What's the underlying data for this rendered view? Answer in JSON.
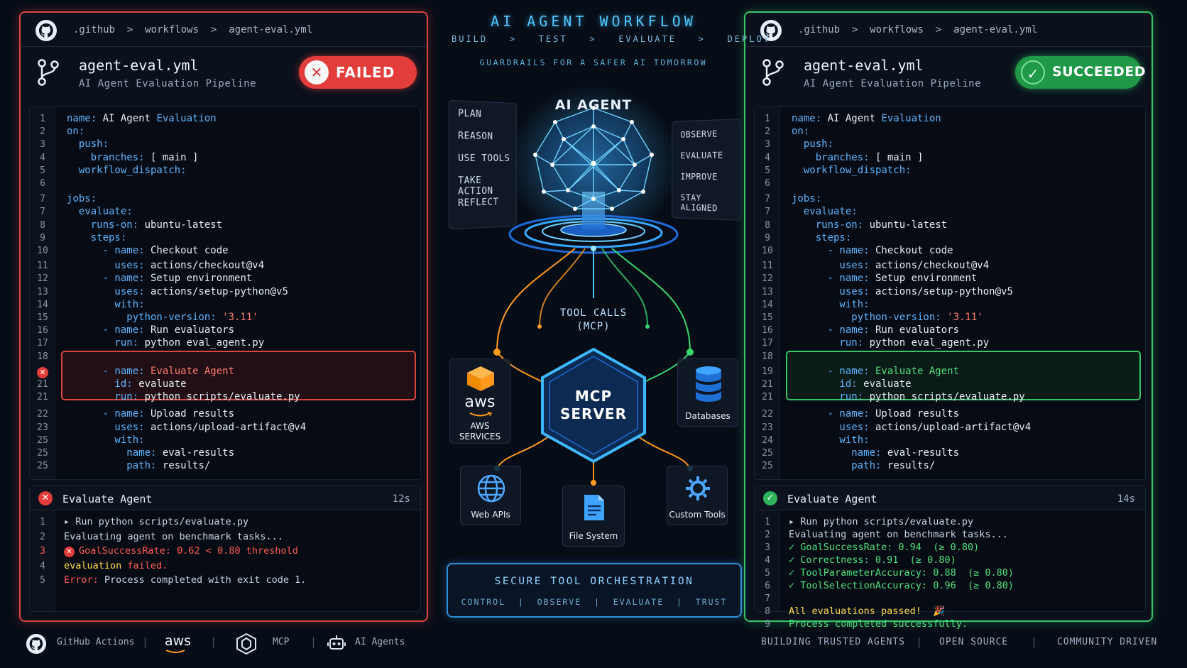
{
  "header": {
    "title": "AI AGENT WORKFLOW",
    "stages": [
      "BUILD",
      "TEST",
      "EVALUATE",
      "DEPLOY"
    ],
    "stage_separator": ">",
    "tagline": "GUARDRAILS FOR A SAFER AI TOMORROW"
  },
  "failed_panel": {
    "breadcrumb": ".github  >  workflows  >  agent-eval.yml",
    "file_title": "agent-eval.yml",
    "file_subtitle": "AI Agent Evaluation Pipeline",
    "status": "FAILED",
    "status_color": "#e23d3a",
    "code_lines": [
      {
        "n": "1",
        "k": "name:",
        "v": " AI Agent ",
        "v2": "Evaluation"
      },
      {
        "n": "2",
        "k": "on:",
        "v": ""
      },
      {
        "n": "3",
        "k": "  push:",
        "v": ""
      },
      {
        "n": "4",
        "k": "    branches:",
        "v": " [ main ]"
      },
      {
        "n": "5",
        "k": "  workflow_dispatch:",
        "v": ""
      },
      {
        "n": "6",
        "k": "",
        "v": ""
      },
      {
        "n": "7",
        "k": "jobs:",
        "v": ""
      },
      {
        "n": "7",
        "k": "  evaluate:",
        "v": ""
      },
      {
        "n": "8",
        "k": "    runs-on:",
        "v": " ubuntu-latest"
      },
      {
        "n": "9",
        "k": "    steps:",
        "v": ""
      },
      {
        "n": "10",
        "k": "      - name:",
        "v": " Checkout code"
      },
      {
        "n": "11",
        "k": "        uses:",
        "v": " actions/checkout@v4"
      },
      {
        "n": "12",
        "k": "      - name:",
        "v": " Setup environment"
      },
      {
        "n": "13",
        "k": "        uses:",
        "v": " actions/setup-python@v5"
      },
      {
        "n": "14",
        "k": "        with:",
        "v": ""
      },
      {
        "n": "15",
        "k": "          python-version:",
        "s": " '3.11'"
      },
      {
        "n": "16",
        "k": "      - name:",
        "v": " Run evaluators"
      },
      {
        "n": "17",
        "k": "        run:",
        "v": " python eval_agent.py"
      },
      {
        "n": "18",
        "k": "",
        "v": ""
      },
      {
        "n": "",
        "k": "      - name:",
        "s": " Evaluate Agent"
      },
      {
        "n": "21",
        "k": "        id:",
        "v": " evaluate"
      },
      {
        "n": "21",
        "k": "        run:",
        "v": " python scripts/evaluate.py"
      },
      {
        "n": "22",
        "k": "      - name:",
        "v": " Upload results"
      },
      {
        "n": "23",
        "k": "        uses:",
        "v": " actions/upload-artifact@v4"
      },
      {
        "n": "25",
        "k": "        with:",
        "v": ""
      },
      {
        "n": "25",
        "k": "          name:",
        "v": " eval-results"
      },
      {
        "n": "25",
        "k": "          path:",
        "v": " results/"
      }
    ],
    "log_title": "Evaluate Agent",
    "log_time": "12s",
    "log_lines": [
      {
        "n": "1",
        "t": "▸ Run python scripts/evaluate.py",
        "c": "plain"
      },
      {
        "n": "2",
        "t": "Evaluating agent on benchmark tasks...",
        "c": "plain"
      },
      {
        "n": "3",
        "t": "GoalSuccessRate: 0.62 < 0.80 threshold",
        "c": "red-t",
        "icon": "x"
      },
      {
        "n": "4",
        "t": "evaluation failed.",
        "c": "yellow-t",
        "pre": "evaluation ",
        "post": "failed."
      },
      {
        "n": "5",
        "t": "Error: Process completed with exit code 1.",
        "c": "red-t"
      }
    ]
  },
  "succeeded_panel": {
    "breadcrumb": ".github  >  workflows  >  agent-eval.yml",
    "file_title": "agent-eval.yml",
    "file_subtitle": "AI Agent Evaluation Pipeline",
    "status": "SUCCEEDED",
    "status_color": "#1f9947",
    "code_lines": [
      {
        "n": "1",
        "k": "name:",
        "v": " AI Agent ",
        "v2": "Evaluation"
      },
      {
        "n": "2",
        "k": "on:",
        "v": ""
      },
      {
        "n": "3",
        "k": "  push:",
        "v": ""
      },
      {
        "n": "4",
        "k": "    branches:",
        "v": " [ main ]"
      },
      {
        "n": "5",
        "k": "  workflow_dispatch:",
        "v": ""
      },
      {
        "n": "6",
        "k": "",
        "v": ""
      },
      {
        "n": "7",
        "k": "jobs:",
        "v": ""
      },
      {
        "n": "7",
        "k": "  evaluate:",
        "v": ""
      },
      {
        "n": "8",
        "k": "    runs-on:",
        "v": " ubuntu-latest"
      },
      {
        "n": "9",
        "k": "    steps:",
        "v": ""
      },
      {
        "n": "10",
        "k": "      - name:",
        "v": " Checkout code"
      },
      {
        "n": "11",
        "k": "        uses:",
        "v": " actions/checkout@v4"
      },
      {
        "n": "12",
        "k": "      - name:",
        "v": " Setup environment"
      },
      {
        "n": "13",
        "k": "        uses:",
        "v": " actions/setup-python@v5"
      },
      {
        "n": "14",
        "k": "        with:",
        "v": ""
      },
      {
        "n": "15",
        "k": "          python-version:",
        "s": " '3.11'"
      },
      {
        "n": "16",
        "k": "      - name:",
        "v": " Run evaluators"
      },
      {
        "n": "17",
        "k": "        run:",
        "v": " python eval_agent.py"
      },
      {
        "n": "18",
        "k": "",
        "v": ""
      },
      {
        "n": "19",
        "k": "      - name:",
        "g": " Evaluate Agent"
      },
      {
        "n": "21",
        "k": "        id:",
        "v": " evaluate"
      },
      {
        "n": "21",
        "k": "        run:",
        "v": " python scripts/evaluate.py"
      },
      {
        "n": "22",
        "k": "      - name:",
        "v": " Upload results"
      },
      {
        "n": "23",
        "k": "        uses:",
        "v": " actions/upload-artifact@v4"
      },
      {
        "n": "24",
        "k": "        with:",
        "v": ""
      },
      {
        "n": "25",
        "k": "          name:",
        "v": " eval-results"
      },
      {
        "n": "25",
        "k": "          path:",
        "v": " results/"
      }
    ],
    "log_title": "Evaluate Agent",
    "log_time": "14s",
    "log_lines": [
      {
        "n": "1",
        "t": "▸ Run python scripts/evaluate.py",
        "c": "plain"
      },
      {
        "n": "2",
        "t": "Evaluating agent on benchmark tasks...",
        "c": "plain"
      },
      {
        "n": "3",
        "t": "✓ GoalSuccessRate: 0.94  (≥ 0.80)",
        "c": "green-t"
      },
      {
        "n": "4",
        "t": "✓ Correctness: 0.91  (≥ 0.80)",
        "c": "green-t"
      },
      {
        "n": "5",
        "t": "✓ ToolParameterAccuracy: 0.88  (≥ 0.80)",
        "c": "green-t"
      },
      {
        "n": "6",
        "t": "✓ ToolSelectionAccuracy: 0.96  (≥ 0.80)",
        "c": "green-t"
      },
      {
        "n": "7",
        "t": "",
        "c": "plain"
      },
      {
        "n": "8",
        "t": "All evaluations passed!  🎉",
        "c": "yellow-t"
      },
      {
        "n": "9",
        "t": "Process completed successfully.",
        "c": "green-t"
      }
    ]
  },
  "agent": {
    "label": "AI AGENT",
    "left_actions": [
      "PLAN",
      "REASON",
      "USE TOOLS",
      "TAKE ACTION",
      "REFLECT"
    ],
    "right_actions": [
      "OBSERVE",
      "EVALUATE",
      "IMPROVE",
      "STAY ALIGNED"
    ],
    "tool_calls": [
      "TOOL CALLS",
      "(MCP)"
    ],
    "server": [
      "MCP",
      "SERVER"
    ],
    "tools": {
      "aws": [
        "AWS",
        "SERVICES"
      ],
      "aws_logo": "aws",
      "databases": "Databases",
      "web_apis": "Web APIs",
      "file_system": "File System",
      "custom_tools": "Custom Tools"
    }
  },
  "orchestration": {
    "title": "SECURE TOOL ORCHESTRATION",
    "items": "CONTROL  |  OBSERVE  |  EVALUATE  |  TRUST"
  },
  "footer": {
    "left": [
      "GitHub Actions",
      "aws",
      "MCP",
      "AI Agents"
    ],
    "right": [
      "BUILDING TRUSTED AGENTS",
      "OPEN SOURCE",
      "COMMUNITY DRIVEN"
    ],
    "separator": "|"
  },
  "colors": {
    "failed": "#d9453e",
    "success": "#37c667",
    "accent_blue": "#4fc7ff",
    "orange": "#ff9a1f"
  }
}
